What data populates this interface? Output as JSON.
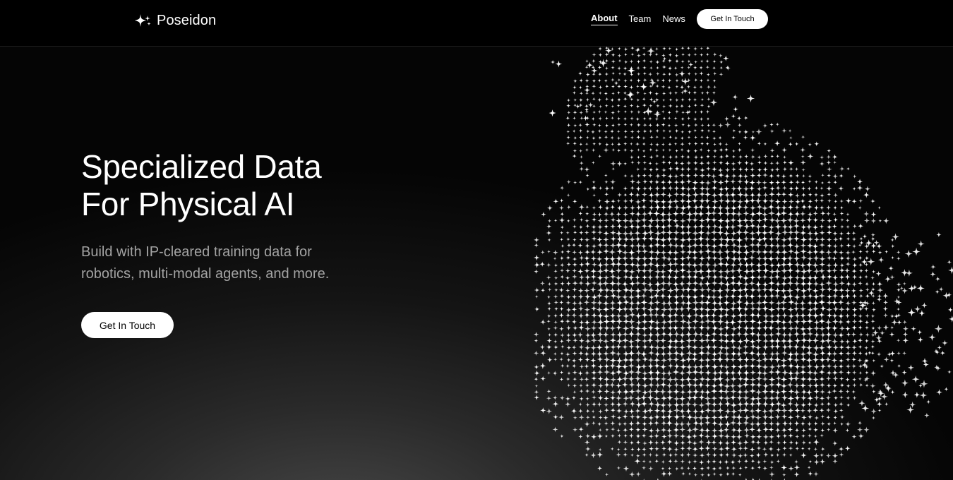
{
  "brand": {
    "name": "Poseidon",
    "icon": "sparkles-icon",
    "colors": {
      "background": "#000000",
      "text": "#ffffff",
      "muted_text": "#a3a3a3",
      "button_bg": "#ffffff",
      "button_text": "#000000"
    }
  },
  "nav": {
    "links": [
      {
        "label": "About",
        "active": true
      },
      {
        "label": "Team",
        "active": false
      },
      {
        "label": "News",
        "active": false
      }
    ],
    "cta_label": "Get In Touch"
  },
  "hero": {
    "title_line1": "Specialized Data",
    "title_line2": "For Physical AI",
    "subtitle_line1": "Build with IP-cleared training data for",
    "subtitle_line2": "robotics, multi-modal agents, and more.",
    "cta_label": "Get In Touch"
  },
  "decoration": {
    "icon": "sparkle-globe-icon"
  }
}
